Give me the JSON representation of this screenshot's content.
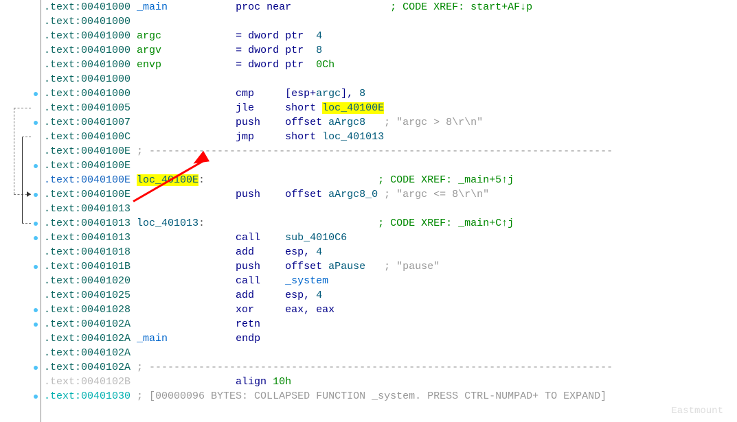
{
  "lines": [
    [
      [
        ".text:00401000 ",
        "c-teal"
      ],
      [
        "_main",
        "c-blue"
      ],
      [
        "           ",
        "c-default"
      ],
      [
        "proc near",
        "c-navy"
      ],
      [
        "                ",
        "c-default"
      ],
      [
        "; CODE XREF: start+AF↓p",
        "c-green"
      ]
    ],
    [
      [
        ".text:00401000",
        "c-teal"
      ]
    ],
    [
      [
        ".text:00401000 ",
        "c-teal"
      ],
      [
        "argc",
        "c-green"
      ],
      [
        "            ",
        "c-default"
      ],
      [
        "= ",
        "c-navy"
      ],
      [
        "dword ptr",
        "c-navy"
      ],
      [
        "  ",
        "c-default"
      ],
      [
        "4",
        "c-darknum"
      ]
    ],
    [
      [
        ".text:00401000 ",
        "c-teal"
      ],
      [
        "argv",
        "c-green"
      ],
      [
        "            ",
        "c-default"
      ],
      [
        "= ",
        "c-navy"
      ],
      [
        "dword ptr",
        "c-navy"
      ],
      [
        "  ",
        "c-default"
      ],
      [
        "8",
        "c-darknum"
      ]
    ],
    [
      [
        ".text:00401000 ",
        "c-teal"
      ],
      [
        "envp",
        "c-green"
      ],
      [
        "            ",
        "c-default"
      ],
      [
        "= ",
        "c-navy"
      ],
      [
        "dword ptr",
        "c-navy"
      ],
      [
        "  ",
        "c-default"
      ],
      [
        "0Ch",
        "c-green"
      ]
    ],
    [
      [
        ".text:00401000",
        "c-teal"
      ]
    ],
    [
      [
        ".text:00401000                 ",
        "c-teal"
      ],
      [
        "cmp",
        "c-navy"
      ],
      [
        "     ",
        "c-default"
      ],
      [
        "[",
        "c-navy"
      ],
      [
        "esp",
        "c-navy"
      ],
      [
        "+",
        "c-navy"
      ],
      [
        "argc",
        "c-darknum"
      ],
      [
        "], ",
        "c-navy"
      ],
      [
        "8",
        "c-darknum"
      ]
    ],
    [
      [
        ".text:00401005                 ",
        "c-teal"
      ],
      [
        "jle",
        "c-navy"
      ],
      [
        "     ",
        "c-default"
      ],
      [
        "short ",
        "c-navy"
      ],
      [
        "loc_40100E",
        "c-darknum",
        true
      ]
    ],
    [
      [
        ".text:00401007                 ",
        "c-teal"
      ],
      [
        "push",
        "c-navy"
      ],
      [
        "    ",
        "c-default"
      ],
      [
        "offset ",
        "c-navy"
      ],
      [
        "aArgc8",
        "c-darknum"
      ],
      [
        "   ",
        "c-default"
      ],
      [
        "; \"argc > 8\\r\\n\"",
        "c-gray"
      ]
    ],
    [
      [
        ".text:0040100C                 ",
        "c-teal"
      ],
      [
        "jmp",
        "c-navy"
      ],
      [
        "     ",
        "c-default"
      ],
      [
        "short ",
        "c-navy"
      ],
      [
        "loc_401013",
        "c-darknum"
      ]
    ],
    [
      [
        ".text:0040100E ",
        "c-teal"
      ],
      [
        "; ---------------------------------------------------------------------------",
        "c-gray"
      ]
    ],
    [
      [
        ".text:0040100E",
        "c-teal"
      ]
    ],
    [
      [
        ".text:0040100E ",
        "c-blueaddr"
      ],
      [
        "loc_40100E",
        "c-darknum",
        true
      ],
      [
        ":",
        "c-default"
      ],
      [
        "                            ",
        "c-default"
      ],
      [
        "; CODE XREF: _main+5↑j",
        "c-green"
      ]
    ],
    [
      [
        ".text:0040100E                 ",
        "c-teal"
      ],
      [
        "push",
        "c-navy"
      ],
      [
        "    ",
        "c-default"
      ],
      [
        "offset ",
        "c-navy"
      ],
      [
        "aArgc8_0 ",
        "c-darknum"
      ],
      [
        "; \"argc <= 8\\r\\n\"",
        "c-gray"
      ]
    ],
    [
      [
        ".text:00401013",
        "c-teal"
      ]
    ],
    [
      [
        ".text:00401013 ",
        "c-teal"
      ],
      [
        "loc_401013",
        "c-darknum"
      ],
      [
        ":",
        "c-default"
      ],
      [
        "                            ",
        "c-default"
      ],
      [
        "; CODE XREF: _main+C↑j",
        "c-green"
      ]
    ],
    [
      [
        ".text:00401013                 ",
        "c-teal"
      ],
      [
        "call",
        "c-navy"
      ],
      [
        "    ",
        "c-default"
      ],
      [
        "sub_4010C6",
        "c-darknum"
      ]
    ],
    [
      [
        ".text:00401018                 ",
        "c-teal"
      ],
      [
        "add",
        "c-navy"
      ],
      [
        "     ",
        "c-default"
      ],
      [
        "esp, ",
        "c-navy"
      ],
      [
        "4",
        "c-darknum"
      ]
    ],
    [
      [
        ".text:0040101B                 ",
        "c-teal"
      ],
      [
        "push",
        "c-navy"
      ],
      [
        "    ",
        "c-default"
      ],
      [
        "offset ",
        "c-navy"
      ],
      [
        "aPause",
        "c-darknum"
      ],
      [
        "   ",
        "c-default"
      ],
      [
        "; \"pause\"",
        "c-gray"
      ]
    ],
    [
      [
        ".text:00401020                 ",
        "c-teal"
      ],
      [
        "call",
        "c-navy"
      ],
      [
        "    ",
        "c-default"
      ],
      [
        "_system",
        "c-blue"
      ]
    ],
    [
      [
        ".text:00401025                 ",
        "c-teal"
      ],
      [
        "add",
        "c-navy"
      ],
      [
        "     ",
        "c-default"
      ],
      [
        "esp, ",
        "c-navy"
      ],
      [
        "4",
        "c-darknum"
      ]
    ],
    [
      [
        ".text:00401028                 ",
        "c-teal"
      ],
      [
        "xor",
        "c-navy"
      ],
      [
        "     ",
        "c-default"
      ],
      [
        "eax, eax",
        "c-navy"
      ]
    ],
    [
      [
        ".text:0040102A                 ",
        "c-teal"
      ],
      [
        "retn",
        "c-navy"
      ]
    ],
    [
      [
        ".text:0040102A ",
        "c-teal"
      ],
      [
        "_main",
        "c-blue"
      ],
      [
        "           ",
        "c-default"
      ],
      [
        "endp",
        "c-navy"
      ]
    ],
    [
      [
        ".text:0040102A",
        "c-teal"
      ]
    ],
    [
      [
        ".text:0040102A ",
        "c-teal"
      ],
      [
        "; ---------------------------------------------------------------------------",
        "c-gray"
      ]
    ],
    [
      [
        ".text:0040102B                 ",
        "c-lightgray"
      ],
      [
        "align ",
        "c-navy"
      ],
      [
        "10h",
        "c-green"
      ]
    ],
    [
      [
        ".text:00401030 ",
        "c-cyan"
      ],
      [
        "; [00000096 BYTES: COLLAPSED FUNCTION _system. PRESS CTRL-NUMPAD+ TO EXPAND]",
        "c-gray"
      ]
    ]
  ],
  "dots_at": [
    6,
    8,
    11,
    13,
    15,
    16,
    18,
    21,
    22,
    25,
    27
  ],
  "jump_arrow_row": 13,
  "watermark": "Eastmount"
}
